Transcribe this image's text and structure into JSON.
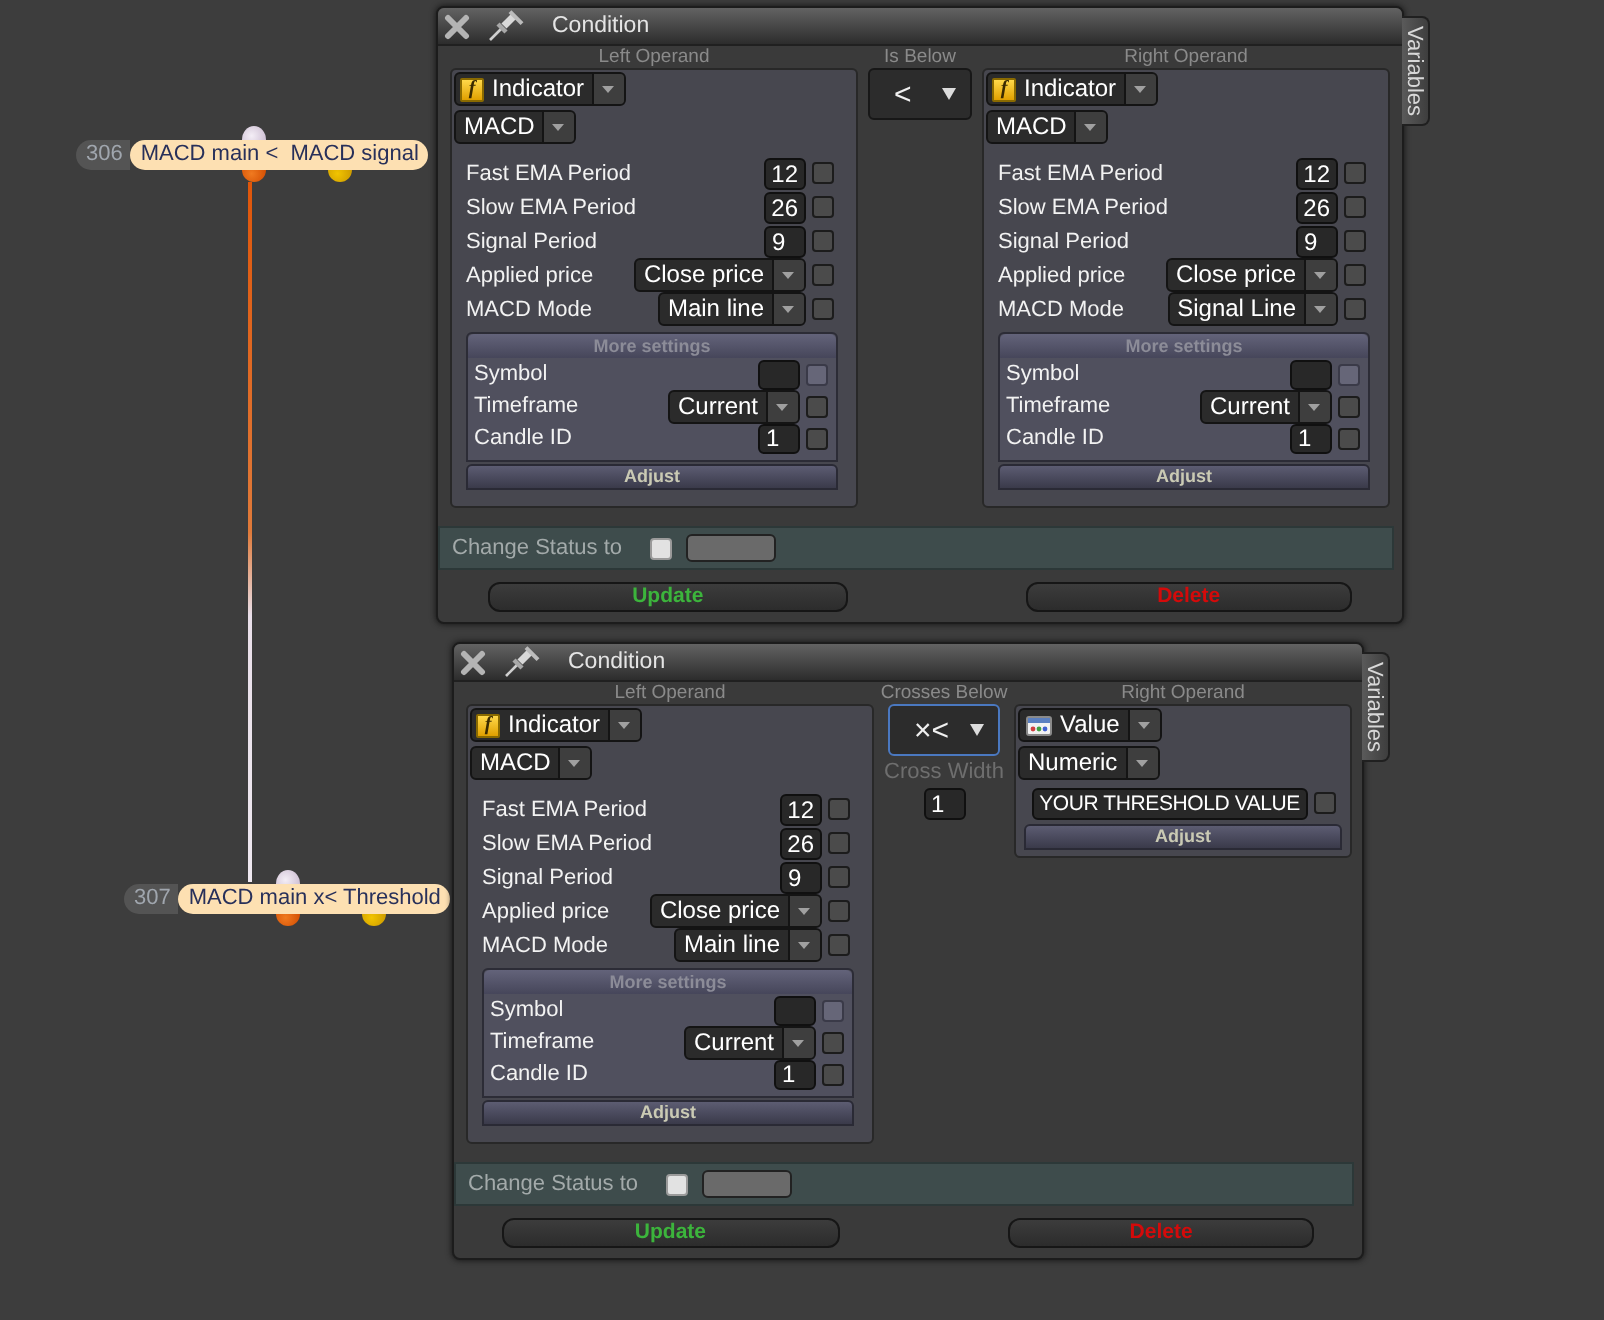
{
  "canvas": {
    "nodes": [
      {
        "number": "306",
        "label": "MACD main <  MACD signal"
      },
      {
        "number": "307",
        "label": "MACD main x< Threshold"
      }
    ]
  },
  "panels": [
    {
      "title": "Condition",
      "side_tab": "Variables",
      "left": {
        "heading": "Left Operand",
        "source": {
          "kind": "indicator",
          "icon_text": "f",
          "label": "Indicator"
        },
        "type": "MACD",
        "params": [
          {
            "kind": "input",
            "label": "Fast EMA Period",
            "value": "12",
            "checked": false
          },
          {
            "kind": "input",
            "label": "Slow EMA Period",
            "value": "26",
            "checked": false
          },
          {
            "kind": "input",
            "label": "Signal Period",
            "value": "9",
            "checked": false
          },
          {
            "kind": "select",
            "label": "Applied price",
            "value": "Close price",
            "checked": false
          },
          {
            "kind": "select",
            "label": "MACD Mode",
            "value": "Main line",
            "checked": false
          }
        ],
        "more_settings": {
          "title": "More settings",
          "params": [
            {
              "kind": "input",
              "label": "Symbol",
              "checked": false,
              "disabled": true
            },
            {
              "kind": "select",
              "label": "Timeframe",
              "value": "Current",
              "checked": false,
              "disabled": false
            },
            {
              "kind": "input",
              "label": "Candle ID",
              "value": "1",
              "checked": false,
              "disabled": false
            }
          ]
        },
        "adjust": "Adjust"
      },
      "operator": {
        "heading": "Is Below",
        "symbol": "<",
        "focused": false
      },
      "right": {
        "heading": "Right Operand",
        "source": {
          "kind": "indicator",
          "icon_text": "f",
          "label": "Indicator"
        },
        "type": "MACD",
        "params": [
          {
            "kind": "input",
            "label": "Fast EMA Period",
            "value": "12",
            "checked": false
          },
          {
            "kind": "input",
            "label": "Slow EMA Period",
            "value": "26",
            "checked": false
          },
          {
            "kind": "input",
            "label": "Signal Period",
            "value": "9",
            "checked": false
          },
          {
            "kind": "select",
            "label": "Applied price",
            "value": "Close price",
            "checked": false
          },
          {
            "kind": "select",
            "label": "MACD Mode",
            "value": "Signal Line",
            "checked": false
          }
        ],
        "more_settings": {
          "title": "More settings",
          "params": [
            {
              "kind": "input",
              "label": "Symbol",
              "checked": false,
              "disabled": true
            },
            {
              "kind": "select",
              "label": "Timeframe",
              "value": "Current",
              "checked": false,
              "disabled": false
            },
            {
              "kind": "input",
              "label": "Candle ID",
              "value": "1",
              "checked": false,
              "disabled": false
            }
          ]
        },
        "adjust": "Adjust"
      },
      "change_status": {
        "label": "Change Status to",
        "checked": false
      },
      "buttons": [
        {
          "kind": "update",
          "label": "Update"
        },
        {
          "kind": "delete",
          "label": "Delete"
        }
      ]
    },
    {
      "title": "Condition",
      "side_tab": "Variables",
      "left": {
        "heading": "Left Operand",
        "source": {
          "kind": "indicator",
          "icon_text": "f",
          "label": "Indicator"
        },
        "type": "MACD",
        "params": [
          {
            "kind": "input",
            "label": "Fast EMA Period",
            "value": "12",
            "checked": false
          },
          {
            "kind": "input",
            "label": "Slow EMA Period",
            "value": "26",
            "checked": false
          },
          {
            "kind": "input",
            "label": "Signal Period",
            "value": "9",
            "checked": false
          },
          {
            "kind": "select",
            "label": "Applied price",
            "value": "Close price",
            "checked": false
          },
          {
            "kind": "select",
            "label": "MACD Mode",
            "value": "Main line",
            "checked": false
          }
        ],
        "more_settings": {
          "title": "More settings",
          "params": [
            {
              "kind": "input",
              "label": "Symbol",
              "checked": false,
              "disabled": true
            },
            {
              "kind": "select",
              "label": "Timeframe",
              "value": "Current",
              "checked": false,
              "disabled": false
            },
            {
              "kind": "input",
              "label": "Candle ID",
              "value": "1",
              "checked": false,
              "disabled": false
            }
          ]
        },
        "adjust": "Adjust"
      },
      "operator": {
        "heading": "Crosses Below",
        "symbol": "×<",
        "focused": true,
        "cross_width": {
          "label": "Cross Width",
          "value": "1"
        }
      },
      "right": {
        "heading": "Right Operand",
        "source": {
          "kind": "value",
          "label": "Value"
        },
        "type": "Numeric",
        "params": [
          {
            "kind": "input",
            "value": "YOUR THRESHOLD VALUE",
            "checked": false
          }
        ],
        "adjust": "Adjust"
      },
      "change_status": {
        "label": "Change Status to",
        "checked": false
      },
      "buttons": [
        {
          "kind": "update",
          "label": "Update"
        },
        {
          "kind": "delete",
          "label": "Delete"
        }
      ]
    }
  ]
}
